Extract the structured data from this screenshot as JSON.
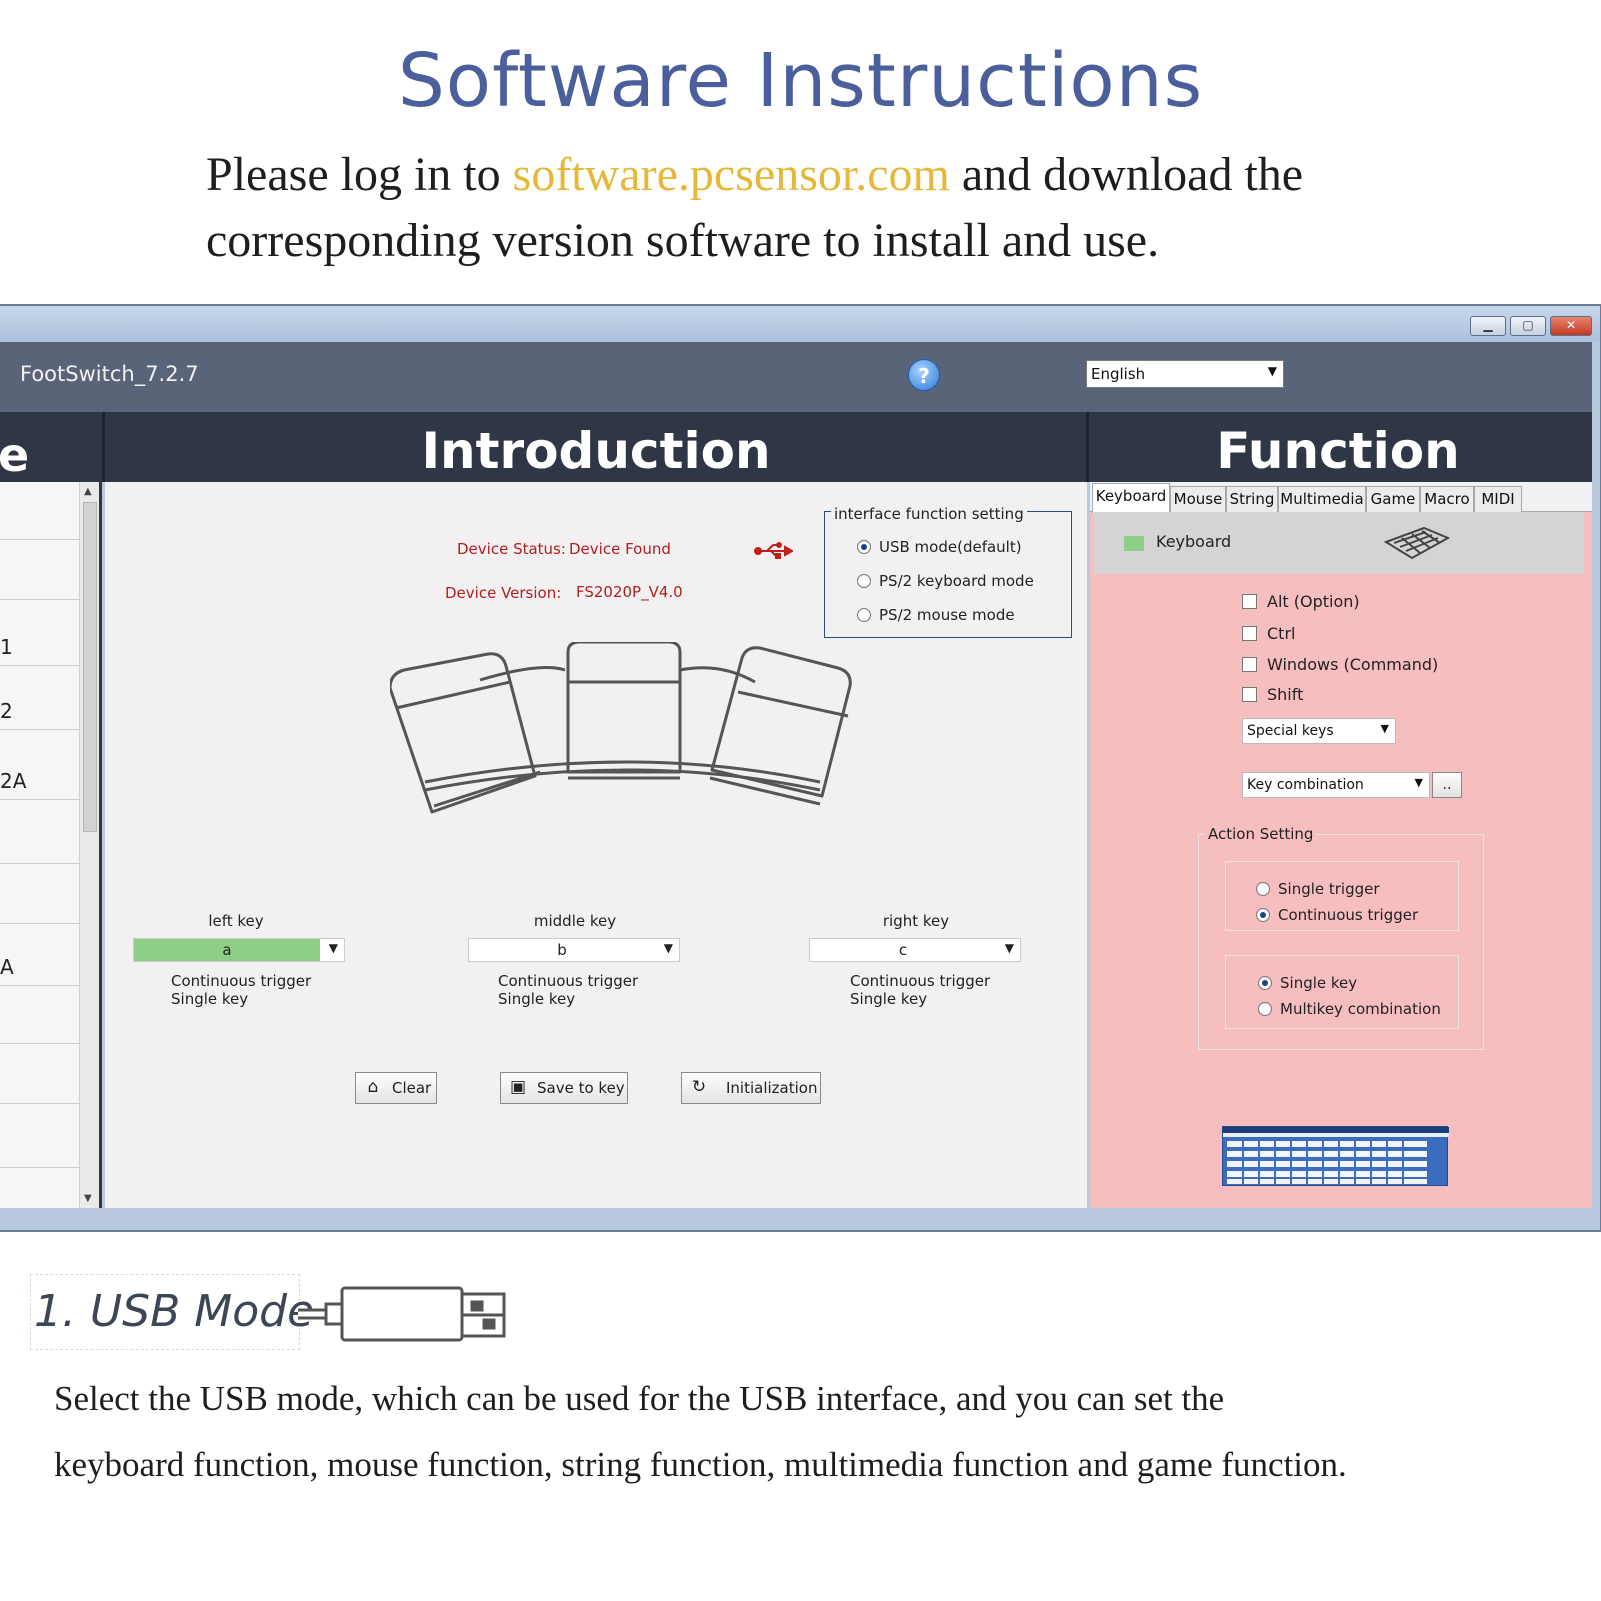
{
  "header": {
    "title": "Software Instructions",
    "line1_before": "Please log in to ",
    "link": "software.pcsensor.com",
    "line1_after": " and download the",
    "line2": "corresponding version software to install and use."
  },
  "window": {
    "app_name": "FootSwitch_7.2.7",
    "language": "English",
    "left_header_stub": "e",
    "intro_header": "Introduction",
    "func_header": "Function",
    "left_list": [
      "",
      "",
      "1",
      "2",
      "2A",
      "",
      "",
      "A",
      "",
      "",
      ""
    ]
  },
  "intro": {
    "device_status_label": "Device Status:",
    "device_status_value": "Device Found",
    "device_version_label": "Device Version:",
    "device_version_value": "FS2020P_V4.0",
    "iface_title": "interface function setting",
    "iface_options": [
      "USB mode(default)",
      "PS/2 keyboard mode",
      "PS/2 mouse mode"
    ],
    "keys": [
      {
        "label": "left key",
        "value": "a",
        "desc1": "Continuous trigger",
        "desc2": "Single key"
      },
      {
        "label": "middle key",
        "value": "b",
        "desc1": "Continuous trigger",
        "desc2": "Single key"
      },
      {
        "label": "right key",
        "value": "c",
        "desc1": "Continuous trigger",
        "desc2": "Single key"
      }
    ],
    "buttons": {
      "clear": "Clear",
      "save": "Save to key",
      "init": "Initialization"
    }
  },
  "function": {
    "tabs": [
      "Keyboard",
      "Mouse",
      "String",
      "Multimedia",
      "Game",
      "Macro",
      "MIDI"
    ],
    "section": "Keyboard",
    "modifiers": [
      "Alt (Option)",
      "Ctrl",
      "Windows (Command)",
      "Shift"
    ],
    "special_keys": "Special keys",
    "key_combination": "Key combination",
    "dots": "..",
    "action_title": "Action Setting",
    "trigger_options": [
      "Single trigger",
      "Continuous trigger"
    ],
    "key_options": [
      "Single key",
      "Multikey  combination"
    ]
  },
  "bottom": {
    "mode_title": "1. USB Mode",
    "line1": "Select the USB mode, which can be used for the USB interface, and you can set the",
    "line2": "keyboard function, mouse function, string function, multimedia function and game function."
  },
  "colors": {
    "title": "#4b5f9c",
    "link": "#e6b83a",
    "function_bg": "#f7bebf",
    "active_key": "#8dcf86"
  },
  "icons": [
    "help-icon",
    "usb-icon",
    "clear-icon",
    "save-icon",
    "refresh-icon",
    "keyboard-icon",
    "usb-plug-icon"
  ]
}
